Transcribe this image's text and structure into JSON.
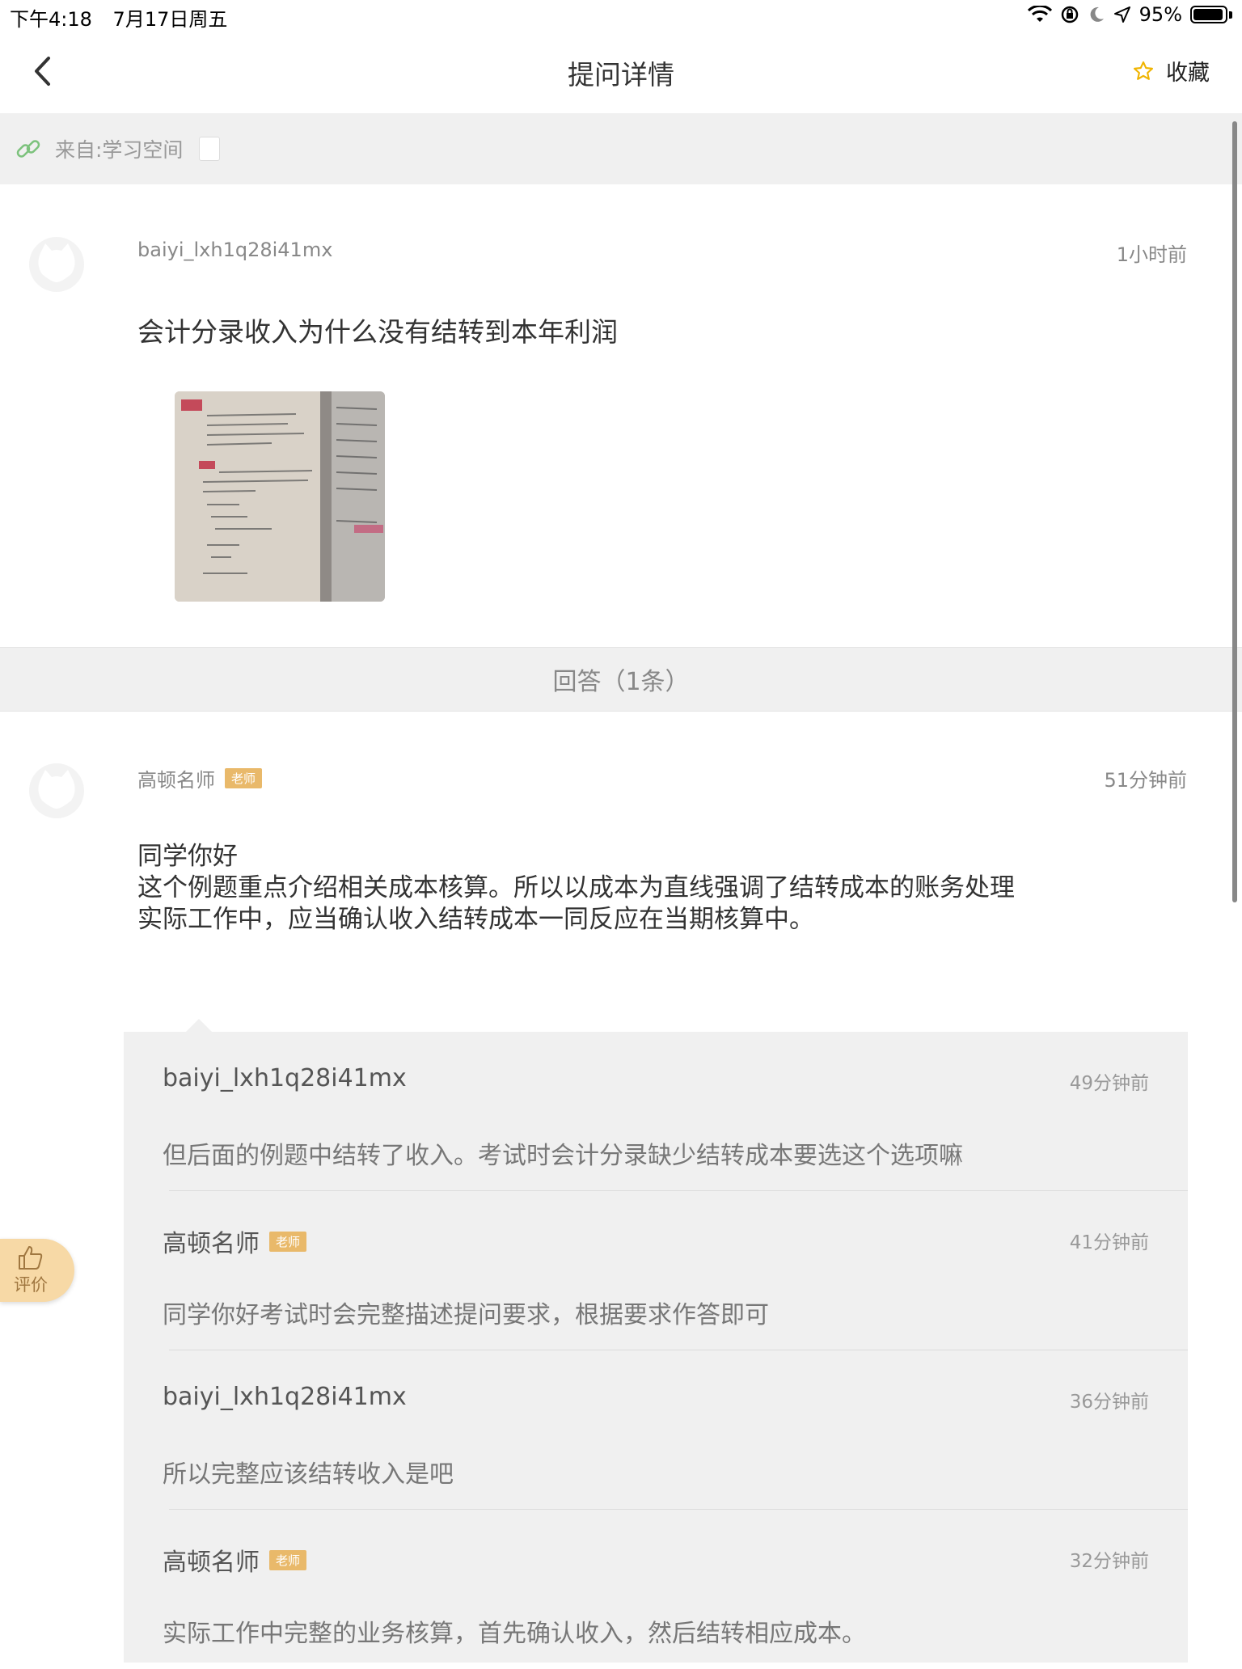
{
  "status_bar": {
    "time": "下午4:18",
    "date": "7月17日周五",
    "battery": "95%",
    "battery_level": 0.95
  },
  "nav": {
    "title": "提问详情",
    "favorite_label": "收藏",
    "back_icon": "chevron-left-icon",
    "favorite_icon": "star-outline-icon"
  },
  "source": {
    "label": "来自:学习空间",
    "icon": "link-icon"
  },
  "question": {
    "user": "baiyi_lxh1q28i41mx",
    "time": "1小时前",
    "text": "会计分录收入为什么没有结转到本年利润"
  },
  "answers_header": "回答（1条）",
  "answer": {
    "user": "高顿名师",
    "badge": "老师",
    "time": "51分钟前",
    "lines": [
      "同学你好",
      "这个例题重点介绍相关成本核算。所以以成本为直线强调了结转成本的账务处理",
      "实际工作中，应当确认收入结转成本一同反应在当期核算中。"
    ]
  },
  "replies": [
    {
      "user": "baiyi_lxh1q28i41mx",
      "badge": "",
      "time": "49分钟前",
      "text": "但后面的例题中结转了收入。考试时会计分录缺少结转成本要选这个选项嘛"
    },
    {
      "user": "高顿名师",
      "badge": "老师",
      "time": "41分钟前",
      "text": "同学你好考试时会完整描述提问要求，根据要求作答即可"
    },
    {
      "user": "baiyi_lxh1q28i41mx",
      "badge": "",
      "time": "36分钟前",
      "text": "所以完整应该结转收入是吧"
    },
    {
      "user": "高顿名师",
      "badge": "老师",
      "time": "32分钟前",
      "text": "实际工作中完整的业务核算，首先确认收入，然后结转相应成本。"
    }
  ],
  "rate_button": {
    "label": "评价",
    "icon": "thumbs-up-icon"
  },
  "colors": {
    "accent": "#e9b96a",
    "section_bg": "#f0f0f0",
    "star": "#f0b400",
    "link_icon": "#7cc27c"
  }
}
